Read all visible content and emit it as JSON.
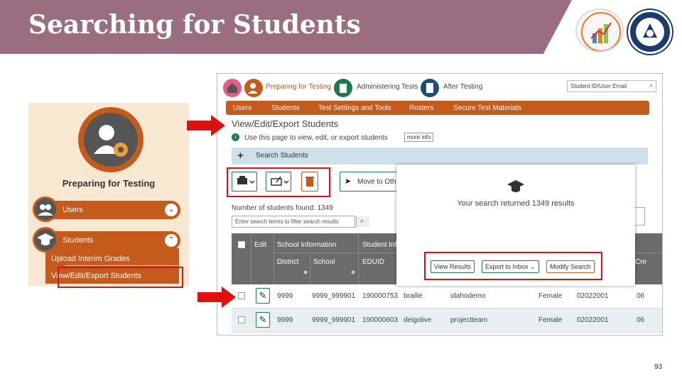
{
  "slide": {
    "title": "Searching for Students",
    "page_number": "93"
  },
  "sidebar": {
    "heading": "Preparing for Testing",
    "items": [
      {
        "label": "Users",
        "chevron": "⌄"
      },
      {
        "label": "Students",
        "chevron": "⌃"
      }
    ],
    "subitems": [
      "Upload Interim Grades",
      "View/Edit/Export Students"
    ]
  },
  "app": {
    "topnav": {
      "preparing": "Preparing for Testing",
      "administering": "Administering Tests",
      "after": "After Testing",
      "search_placeholder": "Student ID/User Email"
    },
    "menu": [
      "Users",
      "Students",
      "Test Settings and Tools",
      "Rosters",
      "Secure Test Materials"
    ],
    "page_title": "View/Edit/Export Students",
    "info_text": "Use this page to view, edit, or export students",
    "more_info": "more info",
    "search_section": "Search Students",
    "move_button": "Move to Oth",
    "found_text": "Number of students found: 1349",
    "filter_placeholder": "Enter search terms to filter search results",
    "table": {
      "headers": {
        "edit": "Edit",
        "school_info": "School Information",
        "student_info": "Student Inf",
        "district": "District",
        "school": "School",
        "eduid": "EDUID",
        "cre": "Cre"
      },
      "rows": [
        {
          "district": "9999",
          "school": "9999_999901",
          "eduid": "190000753",
          "c1": "braille",
          "c2": "idahodemo",
          "c3": "Female",
          "c4": "02022001",
          "c5": "06"
        },
        {
          "district": "9999",
          "school": "9999_999901",
          "eduid": "190000603",
          "c1": "deigolive",
          "c2": "projectteam",
          "c3": "Female",
          "c4": "02022001",
          "c5": "06"
        }
      ]
    },
    "popup": {
      "message": "Your search returned 1349 results",
      "view_results": "View Results",
      "export_inbox": "Export to Inbox",
      "modify_search": "Modify Search"
    }
  },
  "colors": {
    "header_band": "#9a6d80",
    "accent_orange": "#c45a1c",
    "button_green": "#1f7a4e",
    "highlight_red": "#e01010"
  }
}
